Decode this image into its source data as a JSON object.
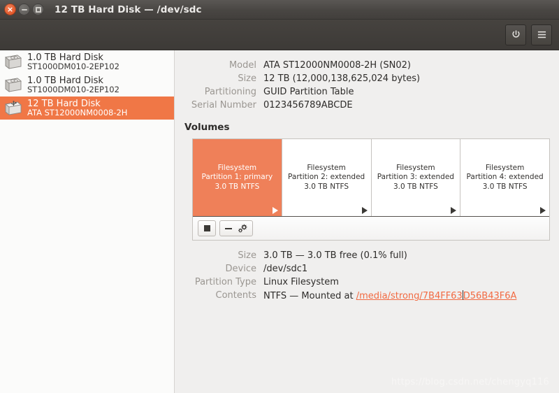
{
  "window": {
    "title": "12 TB Hard Disk — /dev/sdc",
    "controls": {
      "close": "×",
      "minimize": "minimize",
      "maximize": "maximize"
    }
  },
  "header": {
    "power_button": "power-button",
    "menu_button": "menu-button"
  },
  "sidebar": {
    "disks": [
      {
        "name": "1.0 TB Hard Disk",
        "model": "ST1000DM010-2EP102",
        "icon": "internal-hard-disk-icon",
        "selected": false
      },
      {
        "name": "1.0 TB Hard Disk",
        "model": "ST1000DM010-2EP102",
        "icon": "internal-hard-disk-icon",
        "selected": false
      },
      {
        "name": "12 TB Hard Disk",
        "model": "ATA ST12000NM0008-2H",
        "icon": "usb-hard-disk-icon",
        "selected": true
      }
    ]
  },
  "drive_info": {
    "rows": [
      {
        "label": "Model",
        "value": "ATA ST12000NM0008-2H (SN02)"
      },
      {
        "label": "Size",
        "value": "12 TB (12,000,138,625,024 bytes)"
      },
      {
        "label": "Partitioning",
        "value": "GUID Partition Table"
      },
      {
        "label": "Serial Number",
        "value": "0123456789ABCDE"
      }
    ]
  },
  "volumes": {
    "section_title": "Volumes",
    "partitions": [
      {
        "line1": "Filesystem",
        "line2": "Partition 1: primary",
        "line3": "3.0 TB NTFS",
        "selected": true
      },
      {
        "line1": "Filesystem",
        "line2": "Partition 2: extended",
        "line3": "3.0 TB NTFS",
        "selected": false
      },
      {
        "line1": "Filesystem",
        "line2": "Partition 3: extended",
        "line3": "3.0 TB NTFS",
        "selected": false
      },
      {
        "line1": "Filesystem",
        "line2": "Partition 4: extended",
        "line3": "3.0 TB NTFS",
        "selected": false
      }
    ],
    "toolbar": {
      "stop_button": "unmount-stop-button",
      "minus_button": "delete-partition-button",
      "gears_button": "additional-partition-options-button"
    }
  },
  "volume_info": {
    "rows": [
      {
        "label": "Size",
        "value": "3.0 TB — 3.0 TB free (0.1% full)"
      },
      {
        "label": "Device",
        "value": "/dev/sdc1"
      },
      {
        "label": "Partition Type",
        "value": "Linux Filesystem"
      }
    ],
    "contents": {
      "label": "Contents",
      "prefix": "NTFS — Mounted at ",
      "link_before_caret": "/media/strong/7B4FF63",
      "link_after_caret": "D56B43F6A",
      "link_full": "/media/strong/7B4FF63D56B43F6A"
    }
  },
  "watermark": "https://blog.csdn.net/chengyq116",
  "colors": {
    "accent_orange": "#f07746",
    "partition_orange": "#ef8059",
    "link_orange": "#f26a42",
    "titlebar_dark": "#494643",
    "main_bg": "#f0efee",
    "label_gray": "#9a9691"
  }
}
